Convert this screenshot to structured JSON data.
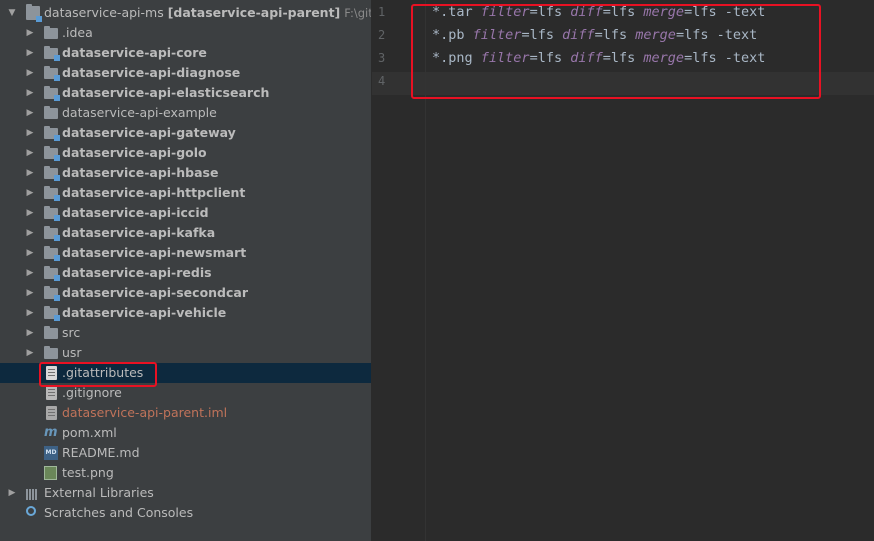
{
  "project_tree": {
    "root": {
      "name": "dataservice-api-ms",
      "module": "[dataservice-api-parent]",
      "path": "F:\\git\\data"
    },
    "items": [
      {
        "label": "idea",
        "display": ".idea",
        "style": "plain",
        "icon": "folder-icon",
        "expandable": true
      },
      {
        "display": "dataservice-api-core",
        "style": "bold",
        "icon": "module-folder-icon",
        "expandable": true
      },
      {
        "display": "dataservice-api-diagnose",
        "style": "bold",
        "icon": "module-folder-icon",
        "expandable": true
      },
      {
        "display": "dataservice-api-elasticsearch",
        "style": "bold",
        "icon": "module-folder-icon",
        "expandable": true
      },
      {
        "display": "dataservice-api-example",
        "style": "plain",
        "icon": "folder-icon",
        "expandable": true
      },
      {
        "display": "dataservice-api-gateway",
        "style": "bold",
        "icon": "module-folder-icon",
        "expandable": true
      },
      {
        "display": "dataservice-api-golo",
        "style": "bold",
        "icon": "module-folder-icon",
        "expandable": true
      },
      {
        "display": "dataservice-api-hbase",
        "style": "bold",
        "icon": "module-folder-icon",
        "expandable": true
      },
      {
        "display": "dataservice-api-httpclient",
        "style": "bold",
        "icon": "module-folder-icon",
        "expandable": true
      },
      {
        "display": "dataservice-api-iccid",
        "style": "bold",
        "icon": "module-folder-icon",
        "expandable": true
      },
      {
        "display": "dataservice-api-kafka",
        "style": "bold",
        "icon": "module-folder-icon",
        "expandable": true
      },
      {
        "display": "dataservice-api-newsmart",
        "style": "bold",
        "icon": "module-folder-icon",
        "expandable": true
      },
      {
        "display": "dataservice-api-redis",
        "style": "bold",
        "icon": "module-folder-icon",
        "expandable": true
      },
      {
        "display": "dataservice-api-secondcar",
        "style": "bold",
        "icon": "module-folder-icon",
        "expandable": true
      },
      {
        "display": "dataservice-api-vehicle",
        "style": "bold",
        "icon": "module-folder-icon",
        "expandable": true
      },
      {
        "display": "src",
        "style": "plain",
        "icon": "folder-icon",
        "expandable": true
      },
      {
        "display": "usr",
        "style": "plain",
        "icon": "folder-icon",
        "expandable": true
      },
      {
        "display": ".gitattributes",
        "style": "plain",
        "icon": "text-file-icon",
        "expandable": false,
        "selected": true
      },
      {
        "display": ".gitignore",
        "style": "plain",
        "icon": "gitignore-file-icon",
        "expandable": false
      },
      {
        "display": "dataservice-api-parent.iml",
        "style": "ignored",
        "icon": "iml-file-icon",
        "expandable": false
      },
      {
        "display": "pom.xml",
        "style": "plain",
        "icon": "maven-icon",
        "expandable": false
      },
      {
        "display": "README.md",
        "style": "plain",
        "icon": "markdown-file-icon",
        "expandable": false
      },
      {
        "display": "test.png",
        "style": "plain",
        "icon": "image-file-icon",
        "expandable": false
      }
    ],
    "bottom_items": [
      {
        "display": "External Libraries",
        "icon": "libraries-icon",
        "expandable": true
      },
      {
        "display": "Scratches and Consoles",
        "icon": "scratches-icon",
        "expandable": false
      }
    ]
  },
  "editor": {
    "line_numbers": [
      "1",
      "2",
      "3",
      "4"
    ],
    "lines": [
      {
        "pattern": "*.tar",
        "parts": [
          [
            "filter",
            "lfs"
          ],
          [
            "diff",
            "lfs"
          ],
          [
            "merge",
            "lfs"
          ]
        ],
        "tail": "-text"
      },
      {
        "pattern": "*.pb",
        "parts": [
          [
            "filter",
            "lfs"
          ],
          [
            "diff",
            "lfs"
          ],
          [
            "merge",
            "lfs"
          ]
        ],
        "tail": "-text"
      },
      {
        "pattern": "*.png",
        "parts": [
          [
            "filter",
            "lfs"
          ],
          [
            "diff",
            "lfs"
          ],
          [
            "merge",
            "lfs"
          ]
        ],
        "tail": "-text"
      }
    ],
    "equals": "="
  },
  "colors": {
    "highlight": "#e81123",
    "selection": "#0d293e",
    "attribute": "#9876aa"
  }
}
